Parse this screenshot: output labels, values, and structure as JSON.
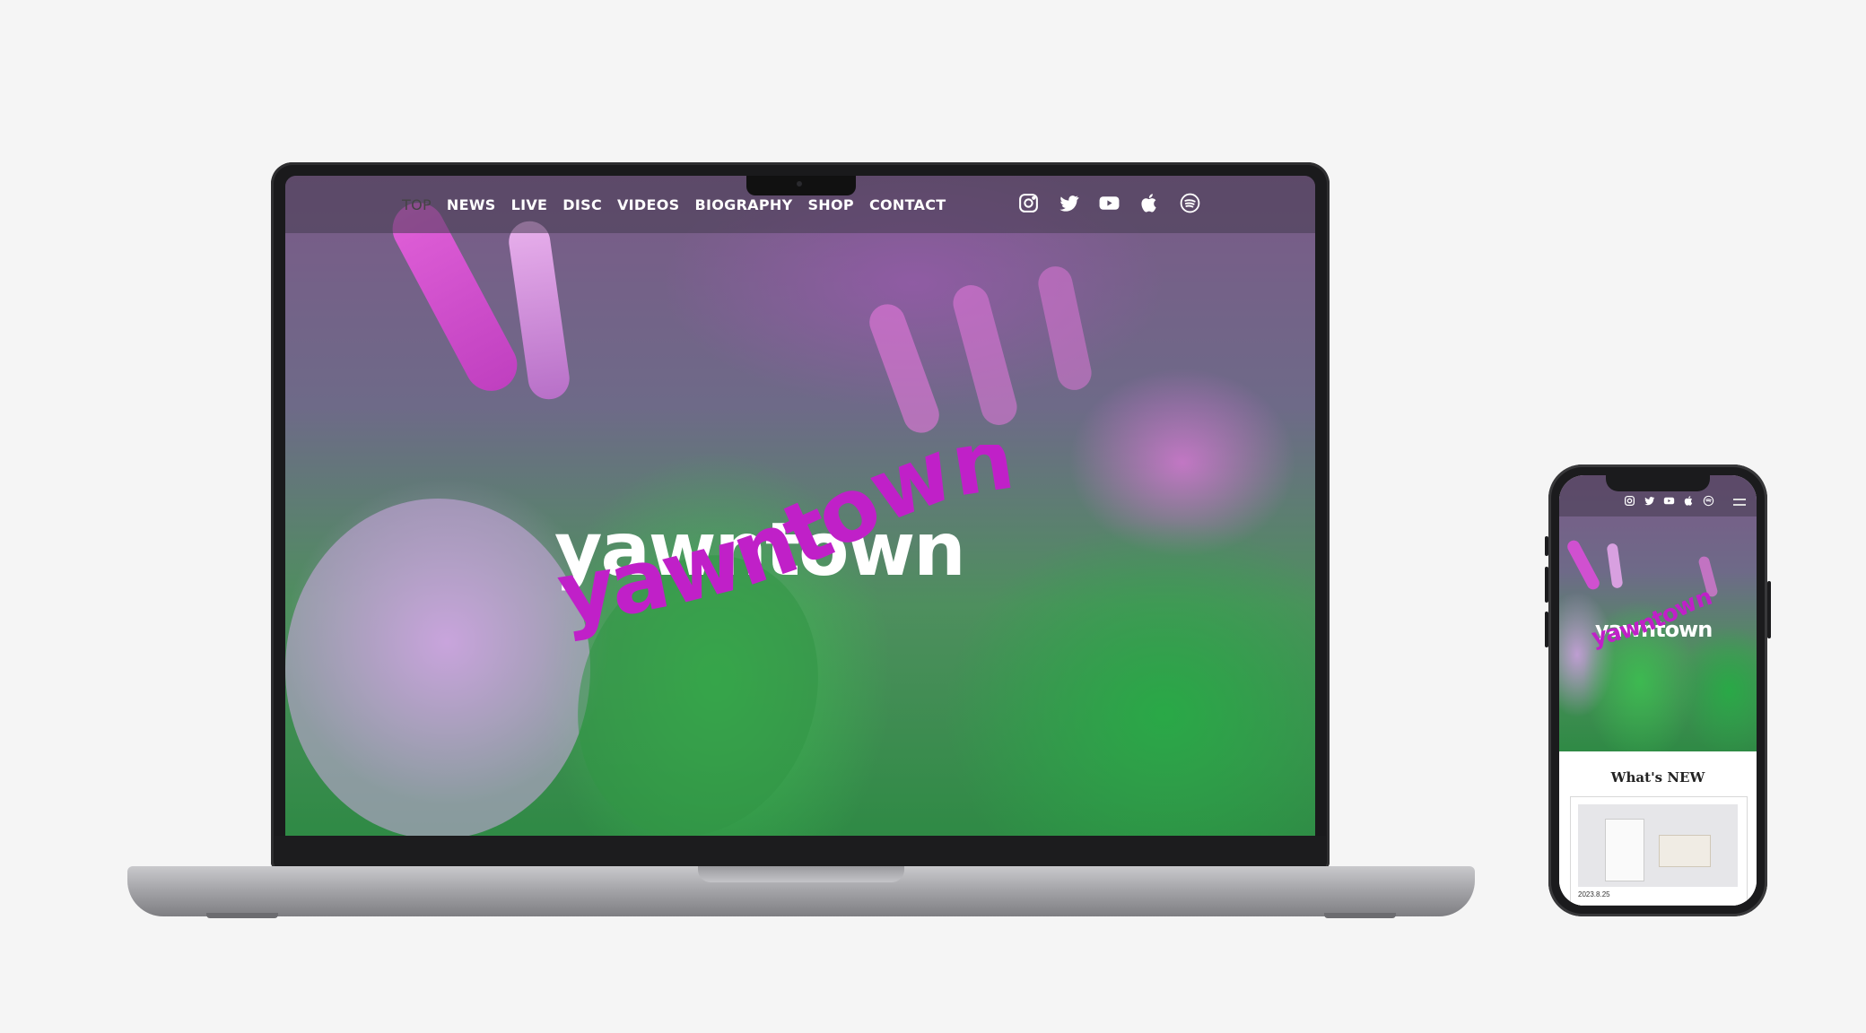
{
  "laptop": {
    "nav": {
      "items": [
        "TOP",
        "NEWS",
        "LIVE",
        "DISC",
        "VIDEOS",
        "BIOGRAPHY",
        "SHOP",
        "CONTACT"
      ],
      "active": "TOP",
      "icons": [
        "instagram-icon",
        "twitter-icon",
        "youtube-icon",
        "apple-music-icon",
        "spotify-icon"
      ]
    },
    "logo": {
      "text": "yawntown",
      "colors": {
        "front": "#c020c8",
        "back": "#ffffff"
      }
    }
  },
  "phone": {
    "icons": [
      "instagram-icon",
      "twitter-icon",
      "youtube-icon",
      "apple-music-icon",
      "spotify-icon",
      "menu-icon"
    ],
    "logo": {
      "text": "yawntown"
    },
    "news": {
      "title": "What's NEW",
      "items": [
        {
          "date": "2023.8.25"
        }
      ]
    }
  },
  "colors": {
    "background": "#f5f5f5",
    "accent": "#c020c8",
    "nav_bar": "rgba(70,60,80,.55)"
  }
}
